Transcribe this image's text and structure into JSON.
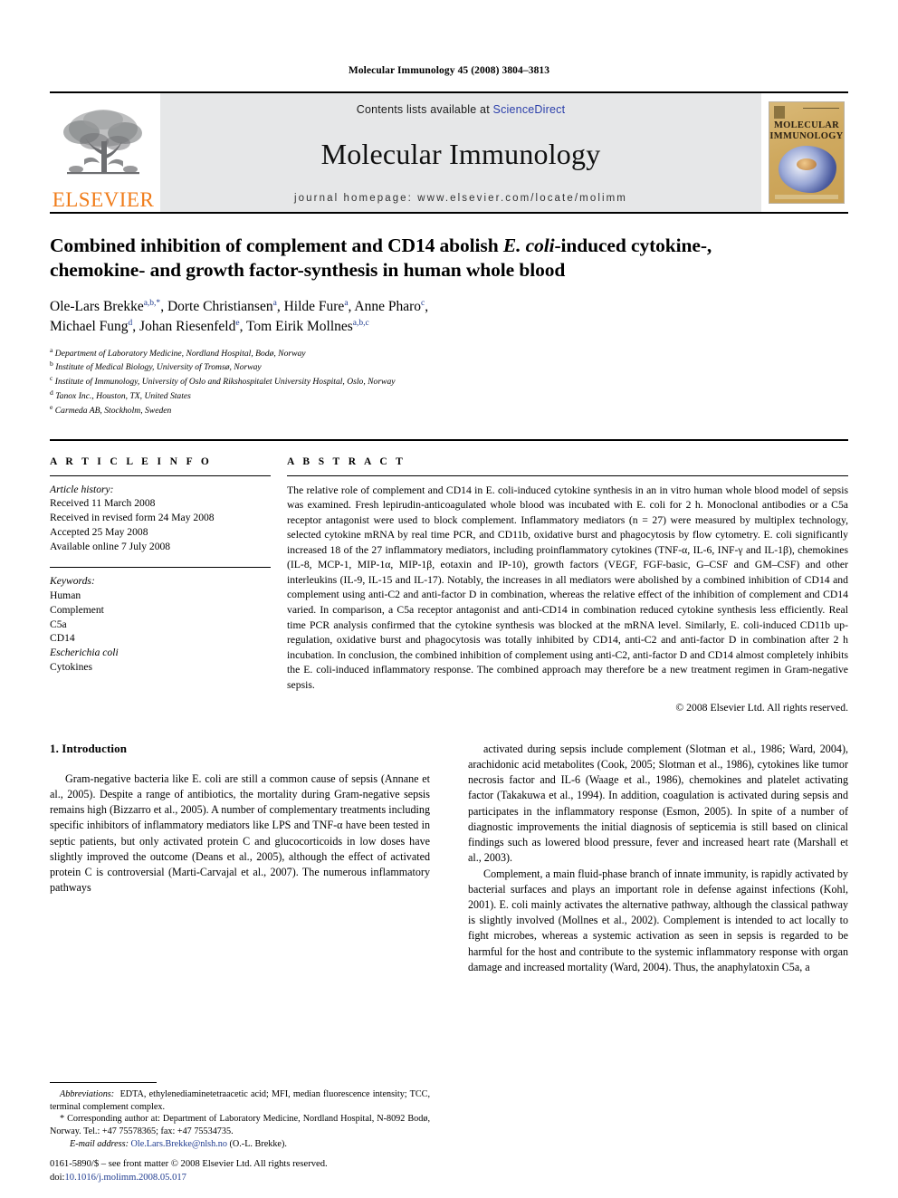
{
  "running_head": "Molecular Immunology 45 (2008) 3804–3813",
  "banner": {
    "publisher_wordmark": "ELSEVIER",
    "contents_prefix": "Contents lists available at ",
    "contents_link": "ScienceDirect",
    "journal_title": "Molecular Immunology",
    "homepage": "journal homepage: www.elsevier.com/locate/molimm",
    "cover_title_line1": "MOLECULAR",
    "cover_title_line2": "IMMUNOLOGY"
  },
  "article": {
    "title_line1_a": "Combined inhibition of complement and CD14 abolish ",
    "title_italic1": "E. coli",
    "title_line1_b": "-induced cytokine-,",
    "title_line2": "chemokine- and growth factor-synthesis in human whole blood",
    "authors_line1": "Ole-Lars Brekke",
    "authors_line1_sup": "a,b,*",
    "authors_line1_b": ", Dorte Christiansen",
    "authors_line1_sup2": "a",
    "authors_line1_c": ", Hilde Fure",
    "authors_line1_sup3": "a",
    "authors_line1_d": ", Anne Pharo",
    "authors_line1_sup4": "c",
    "authors_line1_e": ",",
    "authors_line2_a": "Michael Fung",
    "authors_line2_sup": "d",
    "authors_line2_b": ", Johan Riesenfeld",
    "authors_line2_sup2": "e",
    "authors_line2_c": ", Tom Eirik Mollnes",
    "authors_line2_sup3": "a,b,c",
    "affiliations": [
      {
        "marker": "a",
        "text": "Department of Laboratory Medicine, Nordland Hospital, Bodø, Norway"
      },
      {
        "marker": "b",
        "text": "Institute of Medical Biology, University of Tromsø, Norway"
      },
      {
        "marker": "c",
        "text": "Institute of Immunology, University of Oslo and Rikshospitalet University Hospital, Oslo, Norway"
      },
      {
        "marker": "d",
        "text": "Tanox Inc., Houston, TX, United States"
      },
      {
        "marker": "e",
        "text": "Carmeda AB, Stockholm, Sweden"
      }
    ]
  },
  "article_info": {
    "heading": "A R T I C L E    I N F O",
    "history_label": "Article history:",
    "history": [
      "Received 11 March 2008",
      "Received in revised form 24 May 2008",
      "Accepted 25 May 2008",
      "Available online 7 July 2008"
    ],
    "keywords_label": "Keywords:",
    "keywords": [
      "Human",
      "Complement",
      "C5a",
      "CD14",
      "Escherichia coli",
      "Cytokines"
    ]
  },
  "abstract": {
    "heading": "A B S T R A C T",
    "text": "The relative role of complement and CD14 in E. coli-induced cytokine synthesis in an in vitro human whole blood model of sepsis was examined. Fresh lepirudin-anticoagulated whole blood was incubated with E. coli for 2 h. Monoclonal antibodies or a C5a receptor antagonist were used to block complement. Inflammatory mediators (n = 27) were measured by multiplex technology, selected cytokine mRNA by real time PCR, and CD11b, oxidative burst and phagocytosis by flow cytometry. E. coli significantly increased 18 of the 27 inflammatory mediators, including proinflammatory cytokines (TNF-α, IL-6, INF-γ and IL-1β), chemokines (IL-8, MCP-1, MIP-1α, MIP-1β, eotaxin and IP-10), growth factors (VEGF, FGF-basic, G–CSF and GM–CSF) and other interleukins (IL-9, IL-15 and IL-17). Notably, the increases in all mediators were abolished by a combined inhibition of CD14 and complement using anti-C2 and anti-factor D in combination, whereas the relative effect of the inhibition of complement and CD14 varied. In comparison, a C5a receptor antagonist and anti-CD14 in combination reduced cytokine synthesis less efficiently. Real time PCR analysis confirmed that the cytokine synthesis was blocked at the mRNA level. Similarly, E. coli-induced CD11b up-regulation, oxidative burst and phagocytosis was totally inhibited by CD14, anti-C2 and anti-factor D in combination after 2 h incubation. In conclusion, the combined inhibition of complement using anti-C2, anti-factor D and CD14 almost completely inhibits the E. coli-induced inflammatory response. The combined approach may therefore be a new treatment regimen in Gram-negative sepsis.",
    "copyright": "© 2008 Elsevier Ltd. All rights reserved."
  },
  "introduction": {
    "heading": "1.  Introduction",
    "left_para1": "Gram-negative bacteria like E. coli are still a common cause of sepsis (Annane et al., 2005). Despite a range of antibiotics, the mortality during Gram-negative sepsis remains high (Bizzarro et al., 2005). A number of complementary treatments including specific inhibitors of inflammatory mediators like LPS and TNF-α have been tested in septic patients, but only activated protein C and glucocorticoids in low doses have slightly improved the outcome (Deans et al., 2005), although the effect of activated protein C is controversial (Marti-Carvajal et al., 2007). The numerous inflammatory pathways",
    "right_para1": "activated during sepsis include complement (Slotman et al., 1986; Ward, 2004), arachidonic acid metabolites (Cook, 2005; Slotman et al., 1986), cytokines like tumor necrosis factor and IL-6 (Waage et al., 1986), chemokines and platelet activating factor (Takakuwa et al., 1994). In addition, coagulation is activated during sepsis and participates in the inflammatory response (Esmon, 2005). In spite of a number of diagnostic improvements the initial diagnosis of septicemia is still based on clinical findings such as lowered blood pressure, fever and increased heart rate (Marshall et al., 2003).",
    "right_para2": "Complement, a main fluid-phase branch of innate immunity, is rapidly activated by bacterial surfaces and plays an important role in defense against infections (Kohl, 2001). E. coli mainly activates the alternative pathway, although the classical pathway is slightly involved (Mollnes et al., 2002). Complement is intended to act locally to fight microbes, whereas a systemic activation as seen in sepsis is regarded to be harmful for the host and contribute to the systemic inflammatory response with organ damage and increased mortality (Ward, 2004). Thus, the anaphylatoxin C5a, a"
  },
  "footnotes": {
    "abbreviations_label": "Abbreviations:",
    "abbreviations_text": "EDTA, ethylenediaminetetraacetic acid; MFI, median fluorescence intensity; TCC, terminal complement complex.",
    "corresponding": "* Corresponding author at: Department of Laboratory Medicine, Nordland Hospital, N-8092 Bodø, Norway. Tel.: +47 75578365; fax: +47 75534735.",
    "email_label": "E-mail address:",
    "email": "Ole.Lars.Brekke@nlsh.no",
    "email_suffix": "(O.-L. Brekke).",
    "issn_line": "0161-5890/$ – see front matter © 2008 Elsevier Ltd. All rights reserved.",
    "doi_label": "doi:",
    "doi": "10.1016/j.molimm.2008.05.017"
  },
  "colors": {
    "elsevier_orange": "#F07C1A",
    "link_blue": "#1f3b8f",
    "banner_gray": "#e6e7e8"
  }
}
